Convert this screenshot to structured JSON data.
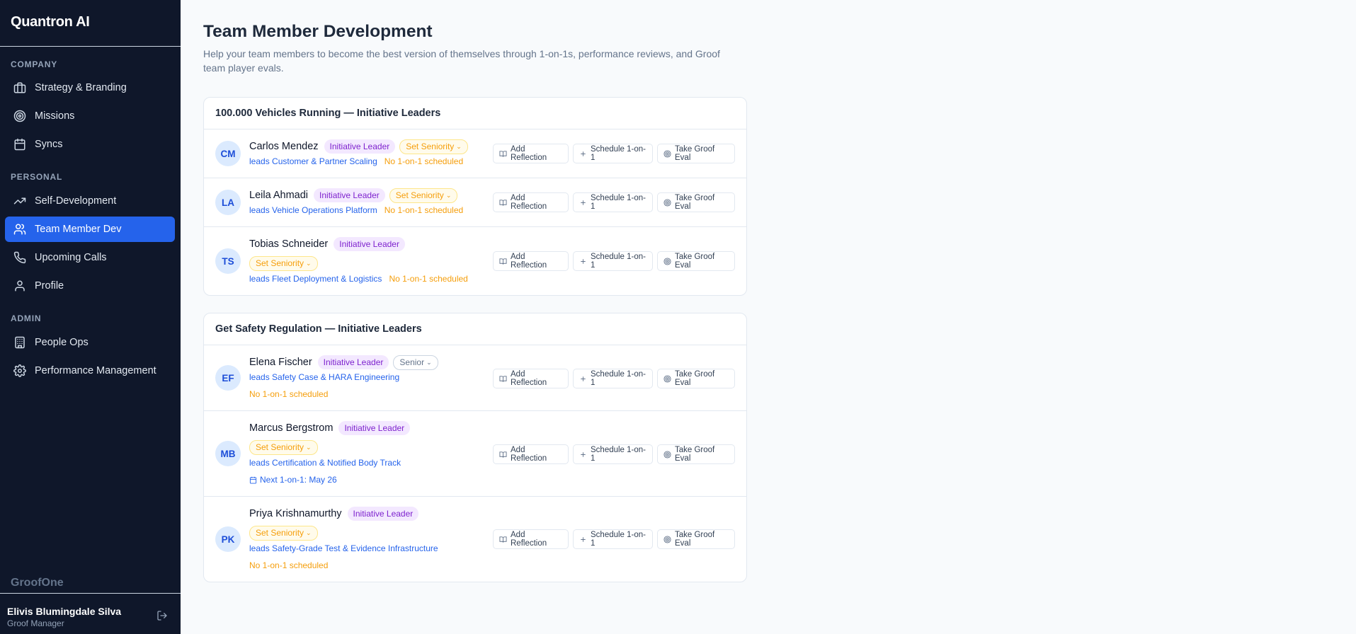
{
  "app": {
    "name": "Quantron AI",
    "footer_brand": "GroofOne"
  },
  "sidebar": {
    "sections": [
      "COMPANY",
      "PERSONAL",
      "ADMIN"
    ],
    "items": [
      {
        "label": "Strategy & Branding",
        "icon": "briefcase-icon"
      },
      {
        "label": "Missions",
        "icon": "target-icon"
      },
      {
        "label": "Syncs",
        "icon": "calendar-icon"
      },
      {
        "label": "Self-Development",
        "icon": "trending-up-icon"
      },
      {
        "label": "Team Member Dev",
        "icon": "users-icon",
        "active": true
      },
      {
        "label": "Upcoming Calls",
        "icon": "phone-icon"
      },
      {
        "label": "Profile",
        "icon": "user-icon"
      },
      {
        "label": "People Ops",
        "icon": "building-icon"
      },
      {
        "label": "Performance Management",
        "icon": "gear-icon"
      }
    ]
  },
  "user": {
    "name": "Elivis Blumingdale Silva",
    "role": "Groof Manager"
  },
  "page": {
    "title": "Team Member Development",
    "subtitle": "Help your team members to become the best version of themselves through 1-on-1s, performance reviews, and Groof team player evals."
  },
  "actions": {
    "reflection": "Add Reflection",
    "schedule": "Schedule 1-on-1",
    "eval": "Take Groof Eval"
  },
  "groups": [
    {
      "title": "100.000 Vehicles Running — Initiative Leaders",
      "members": [
        {
          "initials": "CM",
          "name": "Carlos Mendez",
          "role": "Initiative Leader",
          "seniority": "Set Seniority",
          "leads": "leads Customer & Partner Scaling",
          "status": "No 1-on-1 scheduled"
        },
        {
          "initials": "LA",
          "name": "Leila Ahmadi",
          "role": "Initiative Leader",
          "seniority": "Set Seniority",
          "leads": "leads Vehicle Operations Platform",
          "status": "No 1-on-1 scheduled"
        },
        {
          "initials": "TS",
          "name": "Tobias Schneider",
          "role": "Initiative Leader",
          "seniority": "Set Seniority",
          "leads": "leads Fleet Deployment & Logistics",
          "status": "No 1-on-1 scheduled"
        }
      ]
    },
    {
      "title": "Get Safety Regulation — Initiative Leaders",
      "members": [
        {
          "initials": "EF",
          "name": "Elena Fischer",
          "role": "Initiative Leader",
          "seniority": "Senior",
          "leads": "leads Safety Case & HARA Engineering",
          "status": "No 1-on-1 scheduled"
        },
        {
          "initials": "MB",
          "name": "Marcus Bergstrom",
          "role": "Initiative Leader",
          "seniority": "Set Seniority",
          "leads": "leads Certification & Notified Body Track",
          "status": "Next 1-on-1: May 26"
        },
        {
          "initials": "PK",
          "name": "Priya Krishnamurthy",
          "role": "Initiative Leader",
          "seniority": "Set Seniority",
          "leads": "leads Safety-Grade Test & Evidence Infrastructure",
          "status": "No 1-on-1 scheduled"
        }
      ]
    }
  ],
  "colors": {
    "sidebar_bg": "#0f172a",
    "accent": "#2563eb",
    "role_badge": "#7e22ce",
    "warning": "#f59e0b"
  }
}
